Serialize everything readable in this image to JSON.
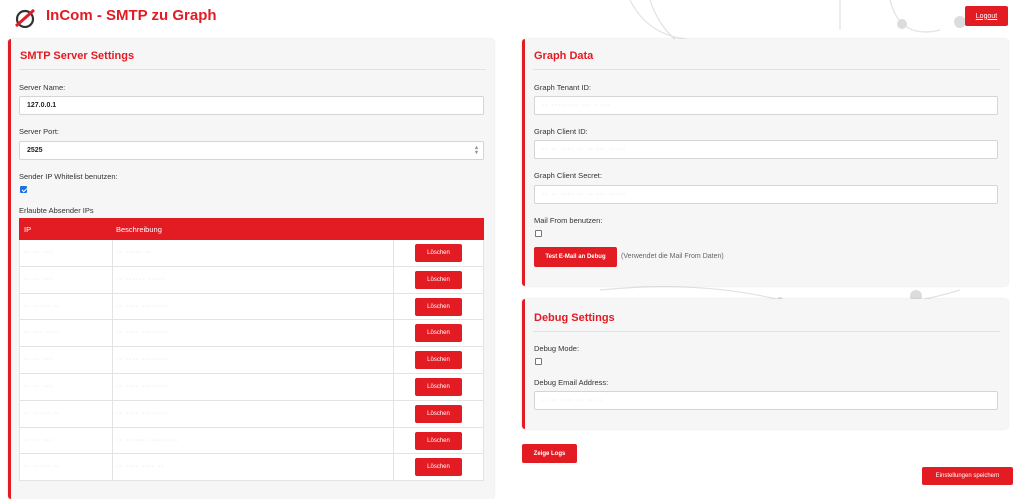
{
  "app": {
    "title": "InCom - SMTP zu Graph",
    "logout_label": "Logout"
  },
  "smtp": {
    "title": "SMTP Server Settings",
    "server_name_label": "Server Name:",
    "server_name_value": "127.0.0.1",
    "server_port_label": "Server Port:",
    "server_port_value": "2525",
    "whitelist_label": "Sender IP Whitelist benutzen:",
    "whitelist_checked": true,
    "allowed_label": "Erlaubte Absender IPs",
    "table": {
      "headers": [
        "IP",
        "Beschreibung"
      ],
      "delete_label": "Löschen",
      "rows": [
        {
          "ip": "·· ·· ···",
          "desc": "·· ····· ··"
        },
        {
          "ip": "·· ·· ···",
          "desc": "·· ······ ·····"
        },
        {
          "ip": "·· ····· ··",
          "desc": "·· ···· ········"
        },
        {
          "ip": "·· ··· ····",
          "desc": "·· ···· ········"
        },
        {
          "ip": "·· ·· ···",
          "desc": "·· ···· ········"
        },
        {
          "ip": "·· ·· ···",
          "desc": "·· ···· ········"
        },
        {
          "ip": "·· ····· ··",
          "desc": "·· ···· ········"
        },
        {
          "ip": "·· ·· ···",
          "desc": "·· ······ ·········"
        },
        {
          "ip": "·· ····· ··",
          "desc": "·· ···· ···· ··"
        }
      ]
    }
  },
  "graph": {
    "title": "Graph Data",
    "tenant_label": "Graph Tenant ID:",
    "tenant_value": "·· ········ ··· · ···",
    "client_label": "Graph Client ID:",
    "client_value": "·· ·· ···· ·· ·· ··· ·····",
    "secret_label": "Graph Client Secret:",
    "secret_value": "·· ·· ···· ·· ·· ··· ·····",
    "mailfrom_label": "Mail From benutzen:",
    "mailfrom_checked": false,
    "test_button": "Test E-Mail an Debug",
    "test_note": "(Verwendet die Mail From Daten)"
  },
  "debug": {
    "title": "Debug Settings",
    "mode_label": "Debug Mode:",
    "mode_checked": false,
    "email_label": "Debug Email Address:",
    "email_value": "·· ·· ···· ·· ·· ··"
  },
  "actions": {
    "show_logs": "Zeige Logs",
    "save": "Einstellungen speichern"
  },
  "colors": {
    "accent": "#e31b23",
    "card_bg": "#f6f6f7",
    "checkbox": "#1a73e8"
  }
}
